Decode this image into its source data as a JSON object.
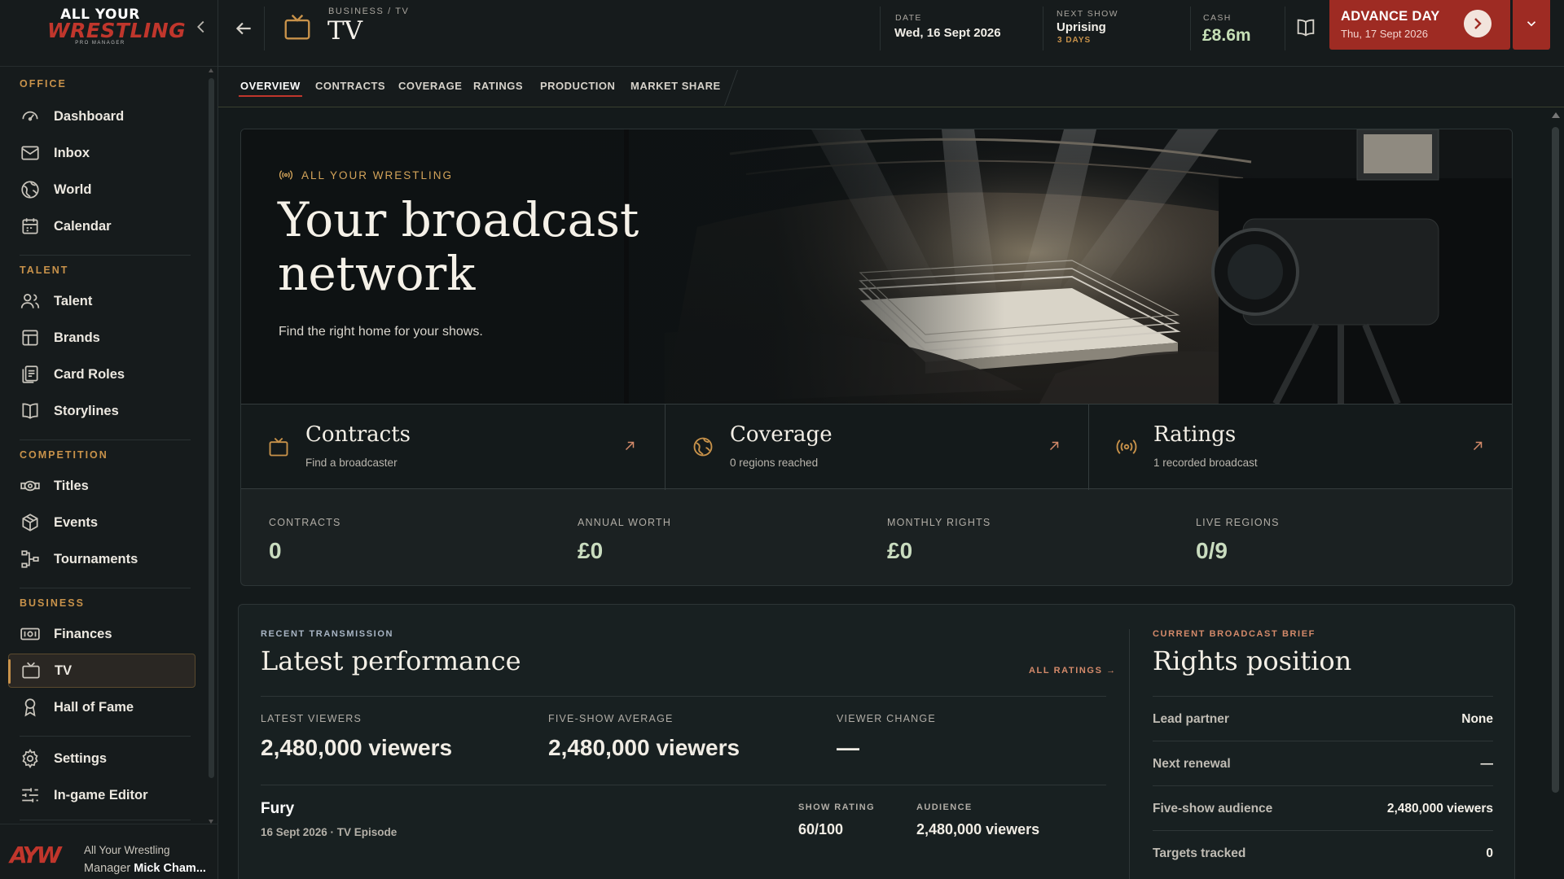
{
  "app": {
    "logo": {
      "line1": "ALL YOUR",
      "line2": "WRESTLING",
      "line3": "PRO MANAGER"
    },
    "accent": "#c8924a",
    "brand_red": "#9e2b23"
  },
  "sidebar": {
    "sections": [
      {
        "label": "OFFICE"
      },
      {
        "label": "TALENT"
      },
      {
        "label": "COMPETITION"
      },
      {
        "label": "BUSINESS"
      }
    ],
    "items": [
      {
        "label": "Dashboard",
        "icon": "gauge-icon"
      },
      {
        "label": "Inbox",
        "icon": "mail-icon"
      },
      {
        "label": "World",
        "icon": "globe-icon"
      },
      {
        "label": "Calendar",
        "icon": "calendar-icon"
      },
      {
        "label": "Talent",
        "icon": "users-icon"
      },
      {
        "label": "Brands",
        "icon": "layout-icon"
      },
      {
        "label": "Card Roles",
        "icon": "cards-icon"
      },
      {
        "label": "Storylines",
        "icon": "book-icon"
      },
      {
        "label": "Titles",
        "icon": "belt-icon"
      },
      {
        "label": "Events",
        "icon": "cube-icon"
      },
      {
        "label": "Tournaments",
        "icon": "bracket-icon"
      },
      {
        "label": "Finances",
        "icon": "cash-icon"
      },
      {
        "label": "TV",
        "icon": "tv-icon",
        "active": true
      },
      {
        "label": "Hall of Fame",
        "icon": "award-icon"
      },
      {
        "label": "Settings",
        "icon": "gear-icon"
      },
      {
        "label": "In-game Editor",
        "icon": "sliders-icon"
      }
    ],
    "user": {
      "logo": "AYW",
      "org": "All Your Wrestling",
      "role": "Manager",
      "name": "Mick Cham..."
    }
  },
  "topbar": {
    "breadcrumb": "BUSINESS / TV",
    "title": "TV",
    "date_label": "DATE",
    "date_value": "Wed, 16 Sept 2026",
    "next_show_label": "NEXT SHOW",
    "next_show_value": "Uprising",
    "next_show_sub": "3 DAYS",
    "cash_label": "CASH",
    "cash_value": "£8.6m",
    "advance_label": "ADVANCE DAY",
    "advance_date": "Thu, 17 Sept 2026"
  },
  "tabs": [
    "OVERVIEW",
    "CONTRACTS",
    "COVERAGE",
    "RATINGS",
    "PRODUCTION",
    "MARKET SHARE"
  ],
  "hero": {
    "kicker": "ALL YOUR WRESTLING",
    "title_line1": "Your broadcast",
    "title_line2": "network",
    "subtitle": "Find the right home for your shows."
  },
  "cards": [
    {
      "title": "Contracts",
      "sub": "Find a broadcaster",
      "icon": "tv-icon"
    },
    {
      "title": "Coverage",
      "sub": "0 regions reached",
      "icon": "globe-icon"
    },
    {
      "title": "Ratings",
      "sub": "1 recorded broadcast",
      "icon": "broadcast-icon"
    }
  ],
  "stats": [
    {
      "label": "CONTRACTS",
      "value": "0"
    },
    {
      "label": "ANNUAL WORTH",
      "value": "£0"
    },
    {
      "label": "MONTHLY RIGHTS",
      "value": "£0"
    },
    {
      "label": "LIVE REGIONS",
      "value": "0/9"
    }
  ],
  "performance": {
    "kicker": "RECENT TRANSMISSION",
    "title": "Latest performance",
    "all_ratings": "ALL RATINGS →",
    "stats": [
      {
        "label": "LATEST VIEWERS",
        "value": "2,480,000 viewers"
      },
      {
        "label": "FIVE-SHOW AVERAGE",
        "value": "2,480,000 viewers"
      },
      {
        "label": "VIEWER CHANGE",
        "value": "—"
      }
    ],
    "show": {
      "name": "Fury",
      "meta": "16 Sept 2026 · TV Episode",
      "rating_label": "SHOW RATING",
      "rating_value": "60/100",
      "audience_label": "AUDIENCE",
      "audience_value": "2,480,000 viewers"
    }
  },
  "rights": {
    "kicker": "CURRENT BROADCAST BRIEF",
    "title": "Rights position",
    "rows": [
      {
        "key": "Lead partner",
        "value": "None"
      },
      {
        "key": "Next renewal",
        "value": "—"
      },
      {
        "key": "Five-show audience",
        "value": "2,480,000 viewers"
      },
      {
        "key": "Targets tracked",
        "value": "0"
      }
    ]
  }
}
